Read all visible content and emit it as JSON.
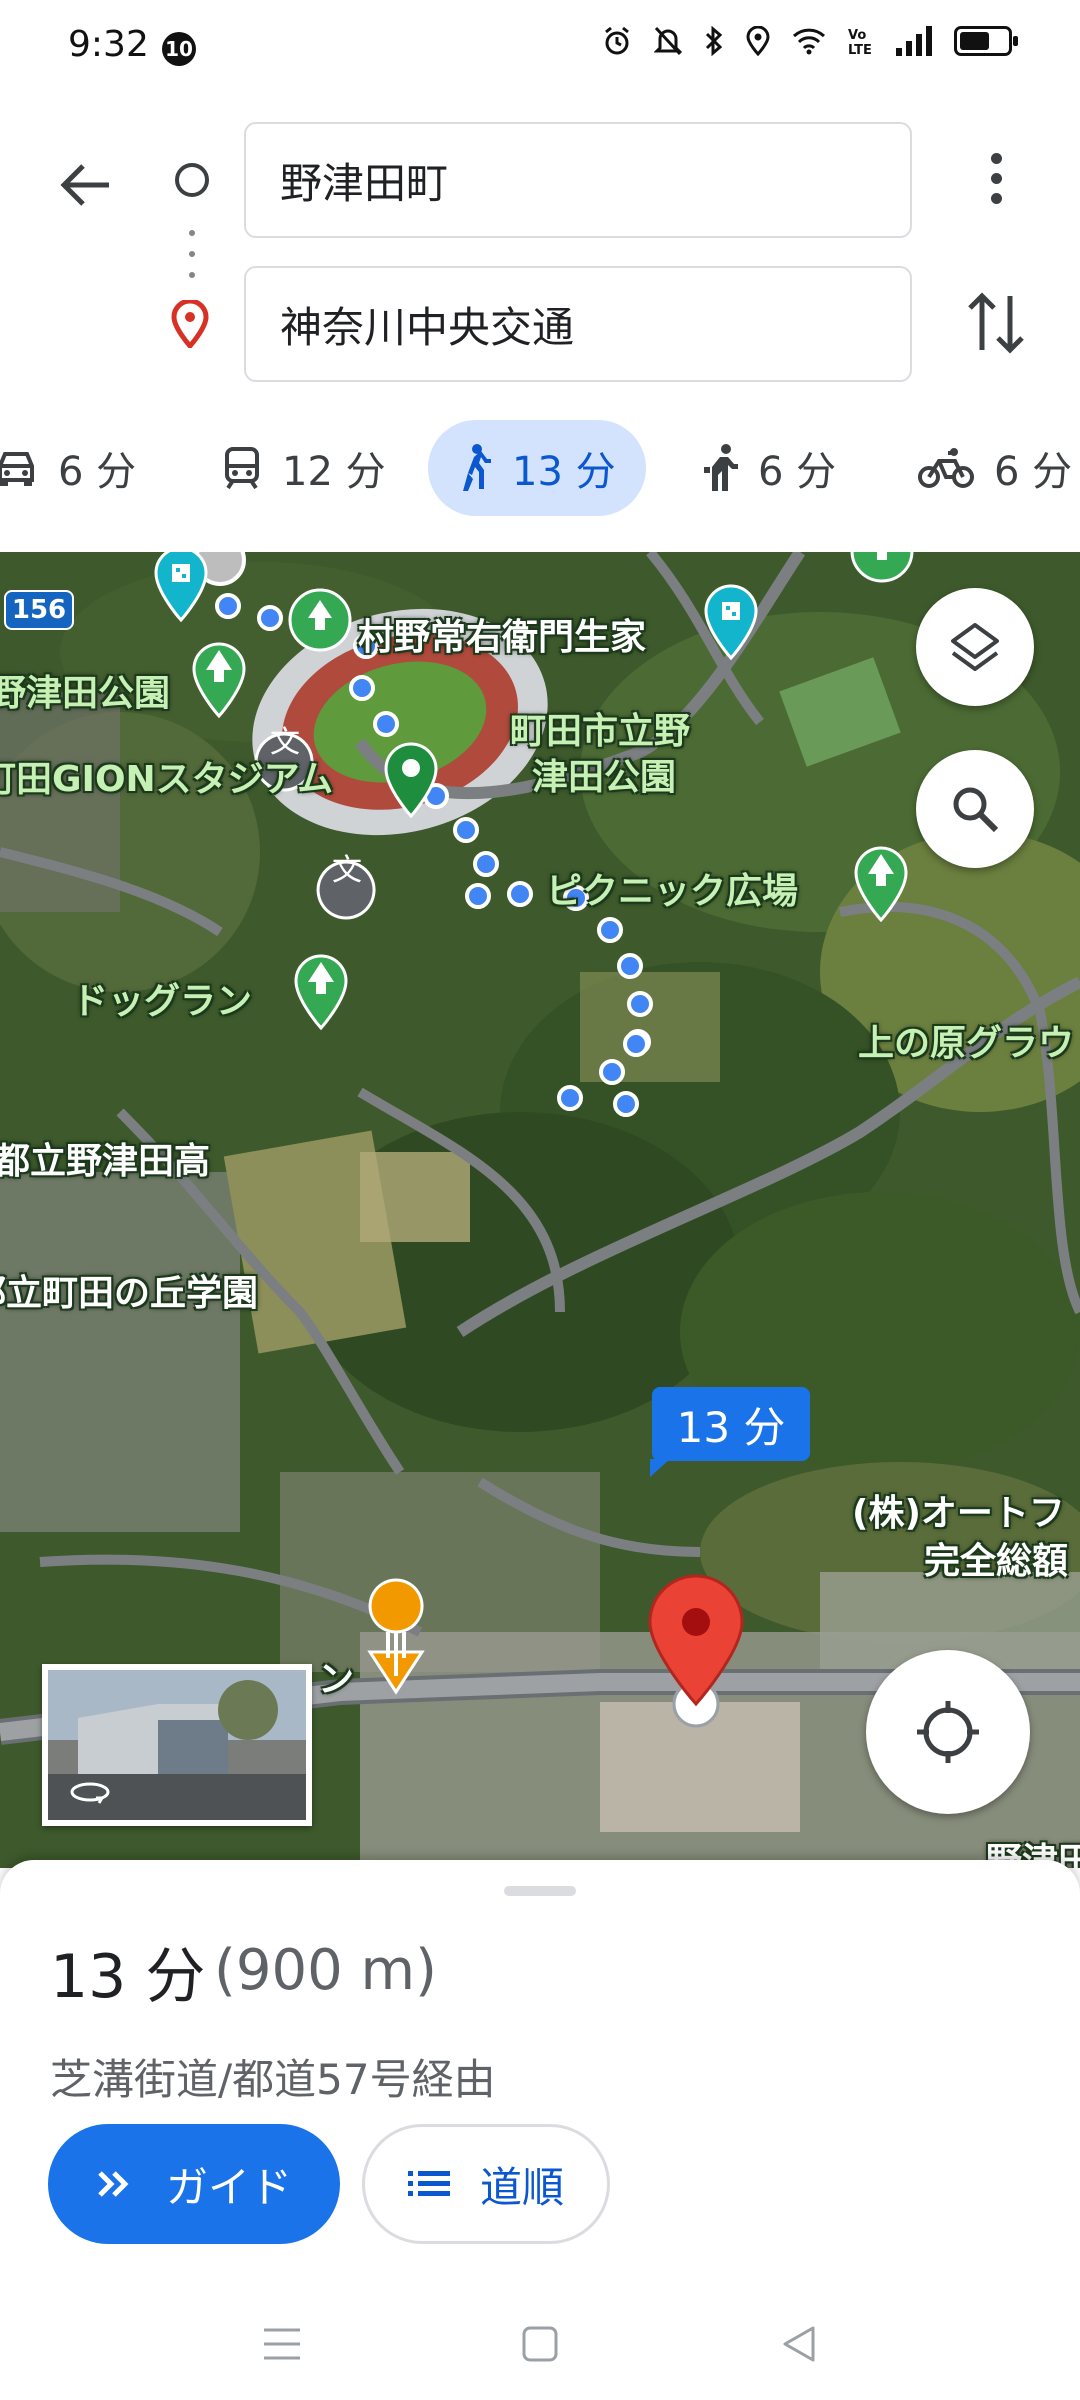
{
  "status_bar": {
    "time": "9:32",
    "notification_count": "10",
    "battery_percent": 62
  },
  "header": {
    "origin": "野津田町",
    "destination": "神奈川中央交通"
  },
  "modes": [
    {
      "name": "car",
      "label": "6 分"
    },
    {
      "name": "transit",
      "label": "12 分"
    },
    {
      "name": "walk",
      "label": "13 分",
      "active": true
    },
    {
      "name": "ride",
      "label": "6 分"
    },
    {
      "name": "bike",
      "label": "6 分"
    }
  ],
  "map": {
    "route_badge": "13 分",
    "road_shield": "156",
    "labels": {
      "murano": "村野常右衛門生家",
      "nozuta_park_left": "野津田公園",
      "machida_park_1": "町田市立野",
      "machida_park_2": "津田公園",
      "stadium": "町田GIONスタジアム",
      "picnic": "ピクニック広場",
      "dogrun": "ドッグラン",
      "uenohara": "上の原グラウ",
      "high_school": "都立野津田高",
      "oka_gakuen": "都立町田の丘学園",
      "auto_1": "(株)オートフ",
      "auto_2": "完全総額",
      "restaurant_tail": "ン",
      "nozu_bottom": "野津田"
    }
  },
  "sheet": {
    "duration": "13 分",
    "distance": "(900 m)",
    "via": "芝溝街道/都道57号経由",
    "guide_label": "ガイド",
    "steps_label": "道順"
  },
  "colors": {
    "accent": "#1a73e8",
    "active_tab_bg": "#d3e3fd",
    "destination_pin": "#ea4335"
  }
}
